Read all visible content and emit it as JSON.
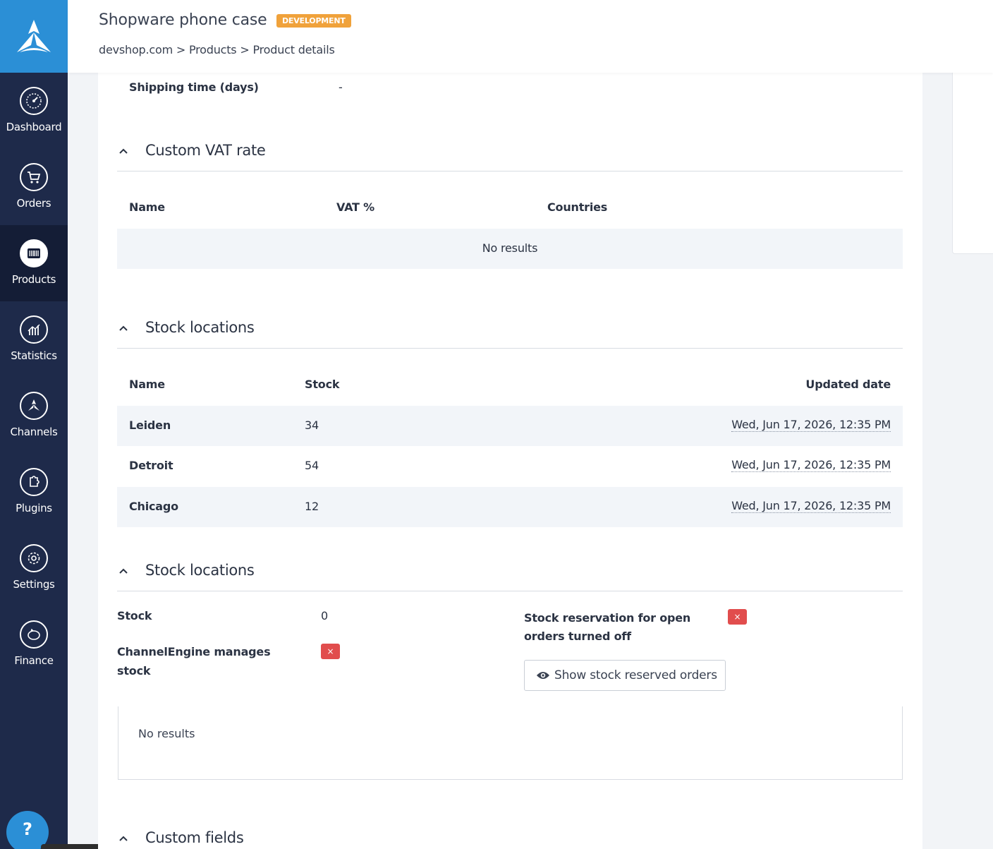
{
  "sidebar": {
    "items": [
      {
        "label": "Dashboard",
        "icon": "speedometer-icon",
        "active": false
      },
      {
        "label": "Orders",
        "icon": "cart-icon",
        "active": false
      },
      {
        "label": "Products",
        "icon": "barcode-icon",
        "active": true
      },
      {
        "label": "Statistics",
        "icon": "chart-icon",
        "active": false
      },
      {
        "label": "Channels",
        "icon": "channels-logo-icon",
        "active": false
      },
      {
        "label": "Plugins",
        "icon": "puzzle-icon",
        "active": false
      },
      {
        "label": "Settings",
        "icon": "gear-icon",
        "active": false
      },
      {
        "label": "Finance",
        "icon": "piggy-bank-icon",
        "active": false
      }
    ],
    "help_label": "?"
  },
  "header": {
    "title": "Shopware phone case",
    "env_badge": "DEVELOPMENT",
    "breadcrumb": [
      "devshop.com",
      ">",
      "Products",
      ">",
      "Product details"
    ]
  },
  "shipping": {
    "label": "Shipping time (days)",
    "value": "-"
  },
  "vat_section": {
    "title": "Custom VAT rate",
    "columns": [
      "Name",
      "VAT %",
      "Countries"
    ],
    "empty_text": "No results"
  },
  "stock_locations": {
    "title": "Stock locations",
    "columns": [
      "Name",
      "Stock",
      "Updated date"
    ],
    "rows": [
      {
        "name": "Leiden",
        "stock": "34",
        "updated": "Wed, Jun 17, 2026, 12:35 PM"
      },
      {
        "name": "Detroit",
        "stock": "54",
        "updated": "Wed, Jun 17, 2026, 12:35 PM"
      },
      {
        "name": "Chicago",
        "stock": "12",
        "updated": "Wed, Jun 17, 2026, 12:35 PM"
      }
    ]
  },
  "stock_summary": {
    "title": "Stock locations",
    "stock_label": "Stock",
    "stock_value": "0",
    "managed_label": "ChannelEngine manages stock",
    "managed_value": "×",
    "reservation_label": "Stock reservation for open orders turned off",
    "reservation_value": "×",
    "show_button": "Show stock reserved orders",
    "empty_text": "No results"
  },
  "custom_fields": {
    "title": "Custom fields"
  },
  "colors": {
    "sidebar": "#1e2a4a",
    "accent": "#2b8fd6",
    "badge": "#f0a23b",
    "error": "#e14d4d"
  }
}
